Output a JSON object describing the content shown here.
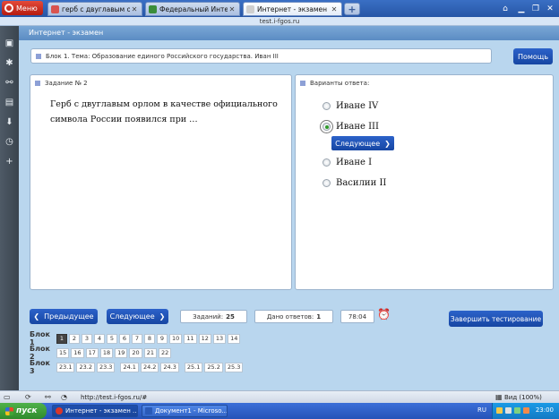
{
  "browser": {
    "menu_label": "Меню",
    "tabs": [
      {
        "label": "герб с двуглавым орло...",
        "favicon_color": "#d9534f",
        "active": false
      },
      {
        "label": "Федеральный Интерне...",
        "favicon_color": "#3a8d3a",
        "active": false
      },
      {
        "label": "Интернет - экзамен",
        "favicon_color": "#cfcfcf",
        "active": true
      }
    ],
    "new_tab": "+",
    "address": "test.i-fgos.ru"
  },
  "page": {
    "header_title": "Интернет - экзамен",
    "block_title": "Блок 1. Тема: Образование единого Российского государства. Иван III",
    "help_label": "Помощь",
    "task": {
      "heading": "Задание № 2",
      "question": "Герб с двуглавым орлом в качестве официального символа России появился при …"
    },
    "answers": {
      "heading": "Варианты ответа:",
      "options": [
        {
          "label": "Иване IV",
          "checked": false
        },
        {
          "label": "Иване III",
          "checked": true
        },
        {
          "label": "Иване I",
          "checked": false
        },
        {
          "label": "Василии II",
          "checked": false
        }
      ],
      "next_inline_label": "Следующее"
    },
    "nav": {
      "prev_label": "Предыдущее",
      "next_label": "Следующее",
      "tasks_label": "Заданий:",
      "tasks_count": "25",
      "answered_label": "Дано ответов:",
      "answered_count": "1",
      "timer": "78:04",
      "finish_label": "Завершить тестирование"
    },
    "blocks": [
      {
        "label": "Блок 1",
        "items": [
          "1",
          "2",
          "3",
          "4",
          "5",
          "6",
          "7",
          "8",
          "9",
          "10",
          "11",
          "12",
          "13",
          "14"
        ],
        "current": "1"
      },
      {
        "label": "Блок 2",
        "items": [
          "15",
          "16",
          "17",
          "18",
          "19",
          "20",
          "21",
          "22"
        ],
        "current": ""
      },
      {
        "label": "Блок 3",
        "items": [
          "23.1",
          "23.2",
          "23.3",
          "24.1",
          "24.2",
          "24.3",
          "25.1",
          "25.2",
          "25.3"
        ],
        "current": ""
      }
    ]
  },
  "statusbar": {
    "url": "http://test.i-fgos.ru/#",
    "zoom": "Вид (100%)"
  },
  "taskbar": {
    "start_label": "пуск",
    "tasks": [
      {
        "label": "Интернет - экзамен ...",
        "active": true,
        "icon_color": "#d9362b"
      },
      {
        "label": "Документ1 - Microso...",
        "active": false,
        "icon_color": "#2a5ab8"
      }
    ],
    "lang": "RU",
    "clock": "23:00"
  },
  "colors": {
    "accent": "#1f55bb",
    "page_background": "#b9d6ee",
    "selected_radio": "#2f9a2a"
  }
}
